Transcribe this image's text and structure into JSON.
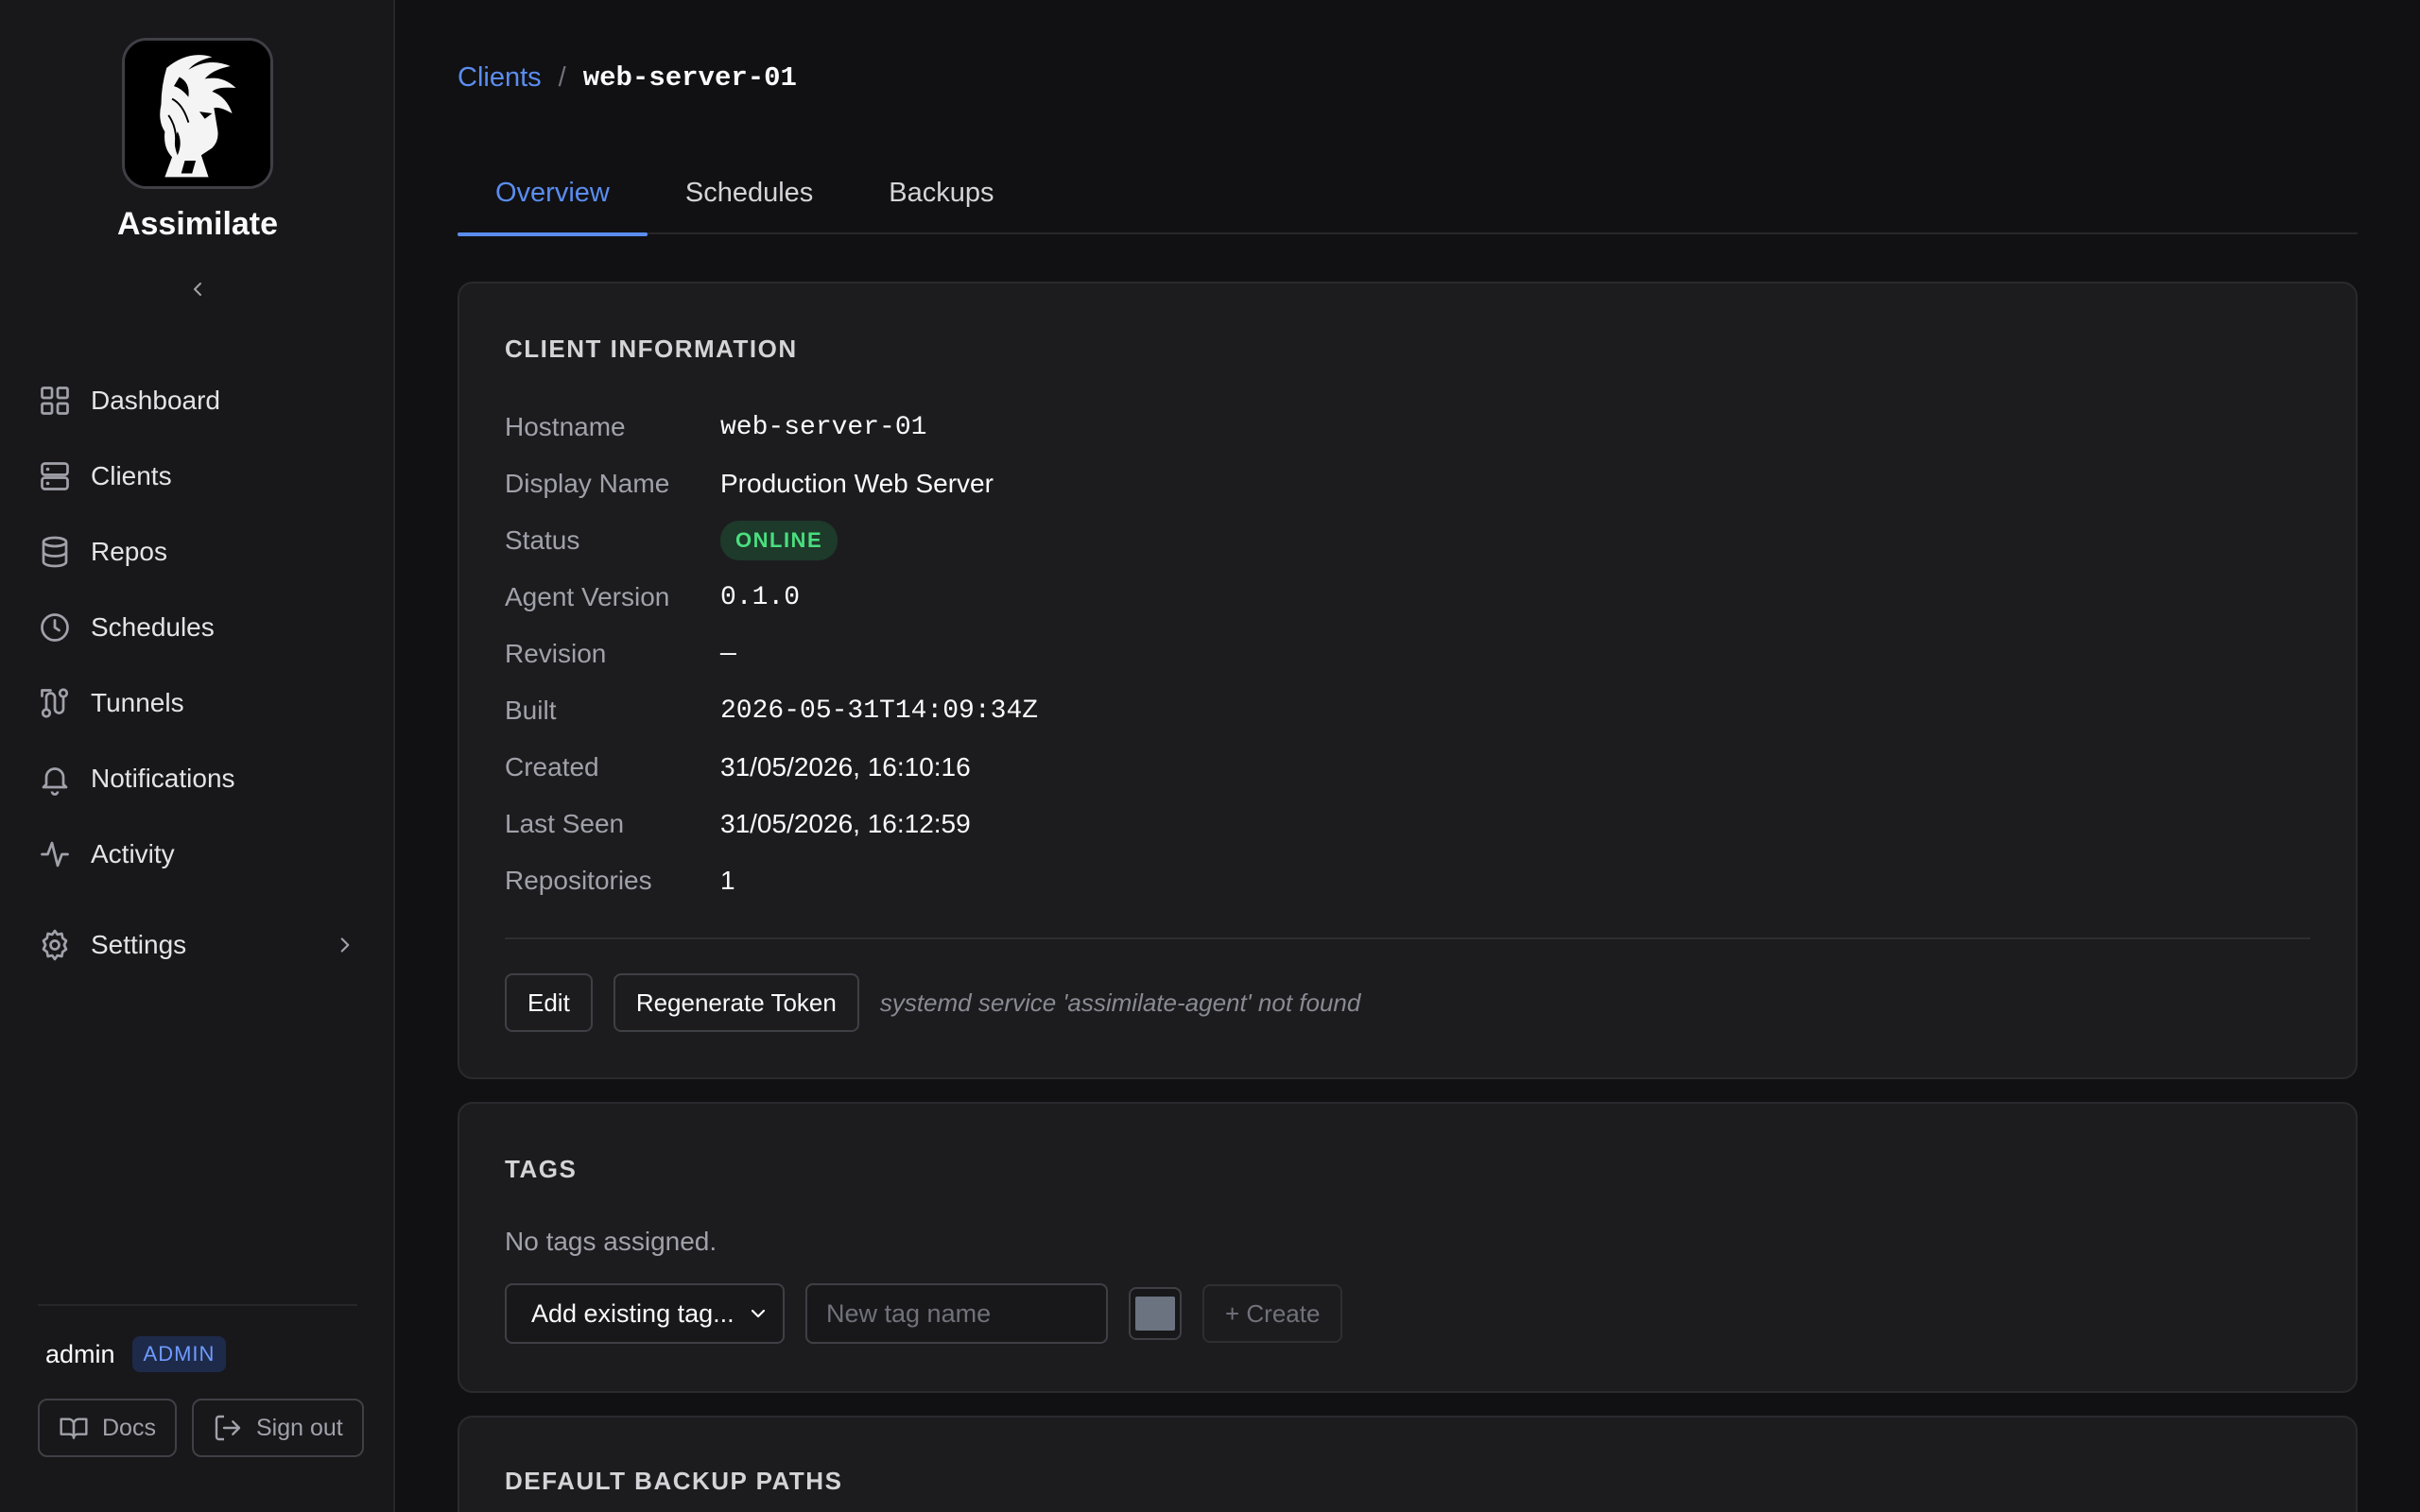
{
  "sidebar": {
    "brand": "Assimilate",
    "collapse_icon": "chevron-left-icon",
    "items": [
      {
        "label": "Dashboard",
        "icon": "dashboard-grid-icon"
      },
      {
        "label": "Clients",
        "icon": "server-icon"
      },
      {
        "label": "Repos",
        "icon": "database-icon"
      },
      {
        "label": "Schedules",
        "icon": "clock-icon"
      },
      {
        "label": "Tunnels",
        "icon": "route-icon"
      },
      {
        "label": "Notifications",
        "icon": "bell-icon"
      },
      {
        "label": "Activity",
        "icon": "activity-icon"
      }
    ],
    "settings": {
      "label": "Settings",
      "icon": "gear-icon"
    },
    "user": {
      "name": "admin",
      "role": "ADMIN"
    },
    "docs_label": "Docs",
    "signout_label": "Sign out"
  },
  "breadcrumb": {
    "parent": "Clients",
    "separator": "/",
    "current": "web-server-01"
  },
  "tabs": [
    {
      "label": "Overview",
      "active": true
    },
    {
      "label": "Schedules",
      "active": false
    },
    {
      "label": "Backups",
      "active": false
    }
  ],
  "client_info": {
    "title": "CLIENT INFORMATION",
    "rows": [
      {
        "label": "Hostname",
        "value": "web-server-01"
      },
      {
        "label": "Display Name",
        "value": "Production Web Server"
      },
      {
        "label": "Status",
        "value": "ONLINE"
      },
      {
        "label": "Agent Version",
        "value": "0.1.0"
      },
      {
        "label": "Revision",
        "value": "—"
      },
      {
        "label": "Built",
        "value": "2026-05-31T14:09:34Z"
      },
      {
        "label": "Created",
        "value": "31/05/2026, 16:10:16"
      },
      {
        "label": "Last Seen",
        "value": "31/05/2026, 16:12:59"
      },
      {
        "label": "Repositories",
        "value": "1"
      }
    ],
    "edit_label": "Edit",
    "regenerate_label": "Regenerate Token",
    "service_hint": "systemd service 'assimilate-agent' not found"
  },
  "tags": {
    "title": "TAGS",
    "empty_text": "No tags assigned.",
    "select_value": "Add existing tag...",
    "new_tag_placeholder": "New tag name",
    "color_value": "#6b7280",
    "create_label": "+ Create"
  },
  "default_paths": {
    "title": "DEFAULT BACKUP PATHS"
  },
  "colors": {
    "accent": "#5b8def",
    "online": "#4ade80",
    "background": "#111114",
    "sidebar": "#18181b"
  }
}
